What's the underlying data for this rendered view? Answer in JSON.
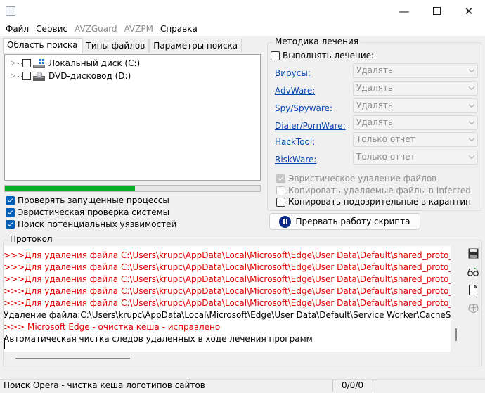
{
  "menu": [
    "Файл",
    "Сервис",
    "AVZGuard",
    "AVZPM",
    "Справка"
  ],
  "tabs": [
    "Область поиска",
    "Типы файлов",
    "Параметры поиска"
  ],
  "tree": [
    "Локальный диск (C:)",
    "DVD-дисковод (D:)"
  ],
  "progress_percent": 51,
  "scan_options": [
    {
      "label": "Проверять запущенные процессы",
      "checked": true
    },
    {
      "label": "Эвристическая проверка системы",
      "checked": true
    },
    {
      "label": "Поиск потенциальных уязвимостей",
      "checked": true
    }
  ],
  "treatment": {
    "title": "Методика лечения",
    "perform_label": "Выполнять лечение:",
    "rows": [
      {
        "threat": "Вирусы:",
        "action": "Удалять"
      },
      {
        "threat": "AdvWare:",
        "action": "Удалять"
      },
      {
        "threat": "Spy/Spyware:",
        "action": "Удалять"
      },
      {
        "threat": "Dialer/PornWare:",
        "action": "Удалять"
      },
      {
        "threat": "HackTool:",
        "action": "Только отчет"
      },
      {
        "threat": "RiskWare:",
        "action": "Только отчет"
      }
    ],
    "options": [
      {
        "label": "Эвристическое удаление файлов",
        "checked": true,
        "enabled": false
      },
      {
        "label": "Копировать удаляемые файлы в  Infected",
        "checked": false,
        "enabled": false
      },
      {
        "label": "Копировать подозрительные в  карантин",
        "checked": false,
        "enabled": true
      }
    ]
  },
  "stop_button": "Прервать работу скрипта",
  "protocol": {
    "title": "Протокол",
    "lines": [
      {
        "text": ">>>Для удаления файла C:\\Users\\krupc\\AppData\\Local\\Microsoft\\Edge\\User Data\\Default\\shared_proto_db\\m",
        "color": "#e00000"
      },
      {
        "text": ">>>Для удаления файла C:\\Users\\krupc\\AppData\\Local\\Microsoft\\Edge\\User Data\\Default\\shared_proto_db\\m",
        "color": "#e00000"
      },
      {
        "text": ">>>Для удаления файла C:\\Users\\krupc\\AppData\\Local\\Microsoft\\Edge\\User Data\\Default\\shared_proto_db\\m",
        "color": "#e00000"
      },
      {
        "text": ">>>Для удаления файла C:\\Users\\krupc\\AppData\\Local\\Microsoft\\Edge\\User Data\\Default\\shared_proto_db\\m",
        "color": "#e00000"
      },
      {
        "text": ">>>Для удаления файла C:\\Users\\krupc\\AppData\\Local\\Microsoft\\Edge\\User Data\\Default\\shared_proto_db\\m",
        "color": "#e00000"
      },
      {
        "text": "Удаление файла:C:\\Users\\krupc\\AppData\\Local\\Microsoft\\Edge\\User Data\\Default\\Service Worker\\CacheStora",
        "color": "#000000"
      },
      {
        "text": " >>>  Microsoft Edge - очистка кеша - исправлено",
        "color": "#e00000"
      },
      {
        "text": "Автоматическая чистка следов удаленных в ходе лечения программ",
        "color": "#000000"
      }
    ]
  },
  "status": {
    "text": "Поиск  Opera - чистка кеша логотипов сайтов",
    "count": "0/0/0"
  },
  "icons": {
    "save": "save-icon",
    "glasses": "glasses-icon",
    "document": "document-icon",
    "brain": "brain-icon"
  }
}
